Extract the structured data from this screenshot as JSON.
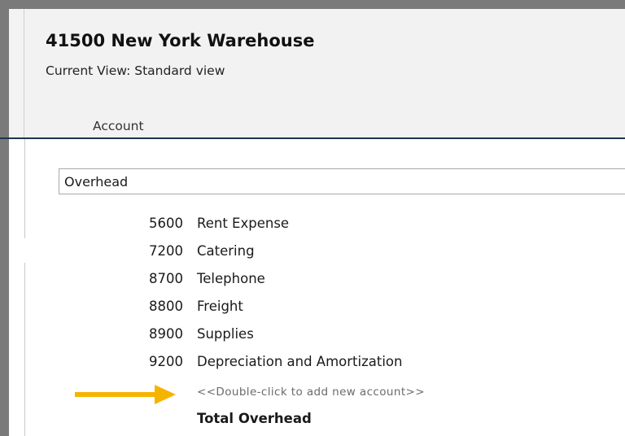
{
  "header": {
    "title": "41500 New York Warehouse",
    "current_view_label": "Current View:",
    "current_view_value": "Standard view",
    "tab_label": "Account"
  },
  "group": {
    "name": "Overhead",
    "accounts": [
      {
        "number": "5600",
        "name": "Rent Expense"
      },
      {
        "number": "7200",
        "name": "Catering"
      },
      {
        "number": "8700",
        "name": "Telephone"
      },
      {
        "number": "8800",
        "name": "Freight"
      },
      {
        "number": "8900",
        "name": "Supplies"
      },
      {
        "number": "9200",
        "name": "Depreciation and Amortization"
      }
    ],
    "add_prompt": "<<Double-click to add new account>>",
    "total_label": "Total Overhead"
  },
  "colors": {
    "arrow": "#f5b400",
    "header_bg": "#f2f2f2",
    "header_rule": "#1f3550",
    "prompt_text": "#6b6b6b"
  },
  "icons": {
    "pointer_arrow": "arrow-right-icon"
  }
}
